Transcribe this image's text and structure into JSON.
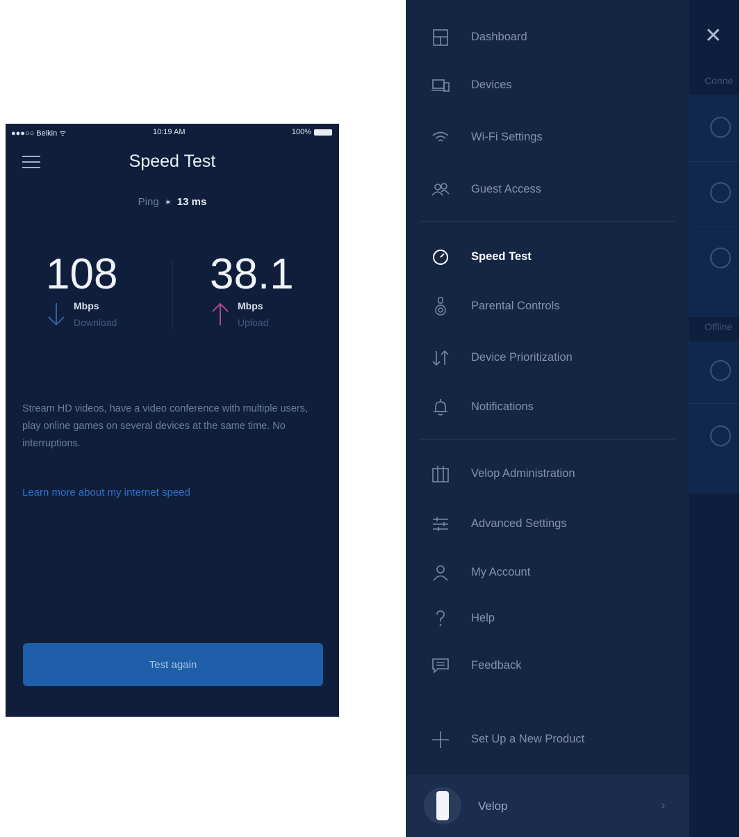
{
  "speed_test": {
    "status": {
      "carrier": "●●●○○ Belkin ᯤ",
      "time": "10:19 AM",
      "battery": "100%"
    },
    "title": "Speed Test",
    "ping": {
      "label": "Ping",
      "value": "13 ms"
    },
    "download": {
      "value": "108",
      "unit": "Mbps",
      "label": "Download"
    },
    "upload": {
      "value": "38.1",
      "unit": "Mbps",
      "label": "Upload"
    },
    "description": "Stream HD videos, have a video conference with multiple users, play online games on several devices at the same time. No interruptions.",
    "learn_more": "Learn more about my internet speed",
    "test_again": "Test again",
    "colors": {
      "background": "#0f1f3b",
      "download_arrow": "#3a5ca0",
      "upload_arrow": "#b04a8c",
      "button": "#1f5ea8"
    }
  },
  "drawer": {
    "items": [
      {
        "label": "Dashboard",
        "icon": "dashboard-icon"
      },
      {
        "label": "Devices",
        "icon": "devices-icon"
      },
      {
        "label": "Wi-Fi Settings",
        "icon": "wifi-icon"
      },
      {
        "label": "Guest Access",
        "icon": "guest-icon"
      },
      {
        "label": "Speed Test",
        "icon": "speedometer-icon",
        "active": true
      },
      {
        "label": "Parental Controls",
        "icon": "parental-icon"
      },
      {
        "label": "Device Prioritization",
        "icon": "prioritization-icon"
      },
      {
        "label": "Notifications",
        "icon": "bell-icon"
      },
      {
        "label": "Velop Administration",
        "icon": "admin-icon"
      },
      {
        "label": "Advanced Settings",
        "icon": "sliders-icon"
      },
      {
        "label": "My Account",
        "icon": "account-icon"
      },
      {
        "label": "Help",
        "icon": "help-icon"
      },
      {
        "label": "Feedback",
        "icon": "feedback-icon"
      },
      {
        "label": "Set Up a New Product",
        "icon": "plus-icon"
      }
    ],
    "footer": {
      "device_name": "Velop"
    }
  },
  "peek": {
    "close": "✕",
    "section1": "Conne",
    "section2": "Offline"
  }
}
